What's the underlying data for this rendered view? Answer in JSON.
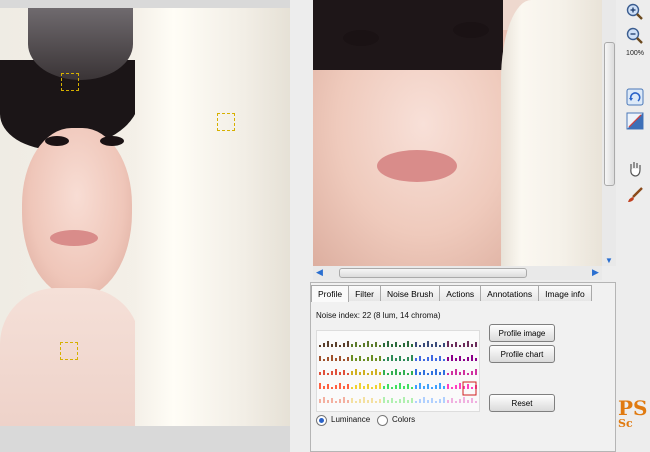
{
  "toolbar": {
    "zoom_level": "100%",
    "tools": [
      "zoom-in-icon",
      "zoom-out-icon",
      "rotate-icon",
      "compare-icon",
      "hand-icon",
      "brush-icon"
    ]
  },
  "tabs": [
    {
      "label": "Profile",
      "active": true
    },
    {
      "label": "Filter",
      "active": false
    },
    {
      "label": "Noise Brush",
      "active": false
    },
    {
      "label": "Actions",
      "active": false
    },
    {
      "label": "Annotations",
      "active": false
    },
    {
      "label": "Image info",
      "active": false
    }
  ],
  "profile": {
    "noise_index": "Noise index:  22 (8 lum, 14 chroma)",
    "profile_image_label": "Profile image",
    "profile_chart_label": "Profile chart",
    "reset_label": "Reset",
    "mode_options": [
      {
        "label": "Luminance",
        "selected": true
      },
      {
        "label": "Colors",
        "selected": false
      }
    ]
  },
  "brand": {
    "line1": "PS",
    "line2": "Sc"
  },
  "colors": {
    "marker": "#d6b000",
    "accent": "#2a62c8",
    "brand": "#e07a10"
  }
}
